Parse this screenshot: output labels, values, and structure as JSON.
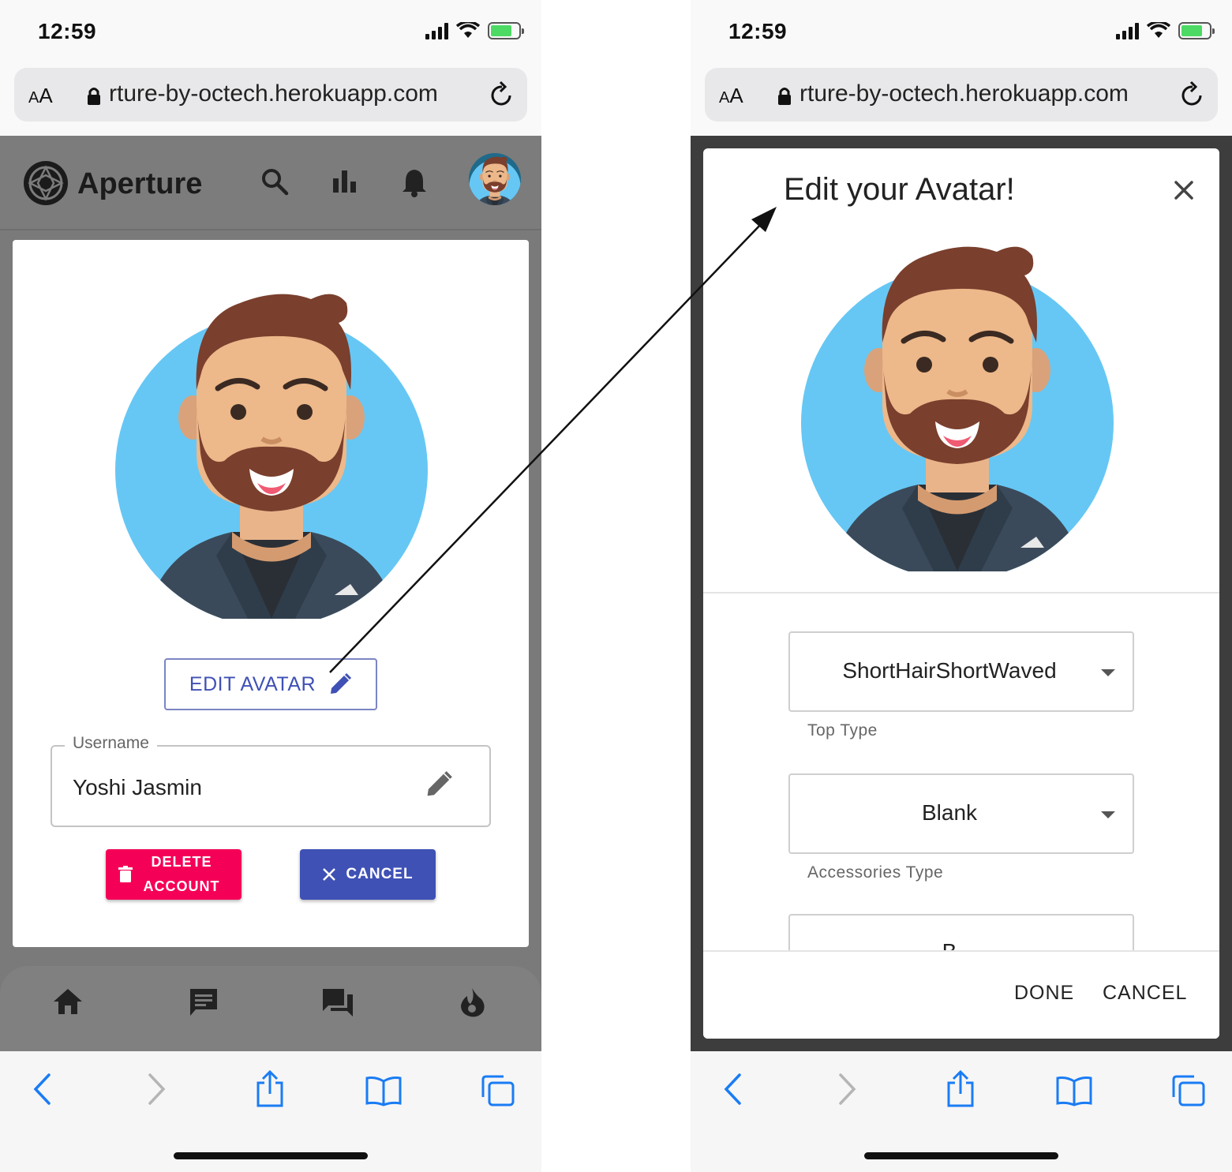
{
  "status_bar": {
    "time": "12:59"
  },
  "browser": {
    "aa_small": "A",
    "aa_large": "A",
    "url": "rture-by-octech.herokuapp.com"
  },
  "app": {
    "brand": "Aperture"
  },
  "profile": {
    "edit_avatar_label": "EDIT AVATAR",
    "username_label": "Username",
    "username_value": "Yoshi Jasmin",
    "delete_label_line1": "DELETE",
    "delete_label_line2": "ACCOUNT",
    "cancel_label": "CANCEL"
  },
  "modal": {
    "title": "Edit your Avatar!",
    "selects": [
      {
        "value": "ShortHairShortWaved",
        "helper": "Top Type"
      },
      {
        "value": "Blank",
        "helper": "Accessories Type"
      },
      {
        "value": "B"
      }
    ],
    "done_label": "DONE",
    "cancel_label": "CANCEL"
  },
  "colors": {
    "primary": "#3f51b5",
    "danger": "#f50057",
    "avatar_bg": "#66c7f4",
    "overlay": "#7a7a7a",
    "modal_backdrop": "#3d3d3d"
  },
  "icons": {
    "header": [
      "search-icon",
      "bar-chart-icon",
      "bell-icon",
      "user-avatar"
    ],
    "bottom_nav": [
      "home-icon",
      "message-icon",
      "forum-icon",
      "fire-icon"
    ],
    "safari_toolbar": [
      "back-icon",
      "forward-icon",
      "share-icon",
      "bookmarks-icon",
      "tabs-icon"
    ]
  }
}
